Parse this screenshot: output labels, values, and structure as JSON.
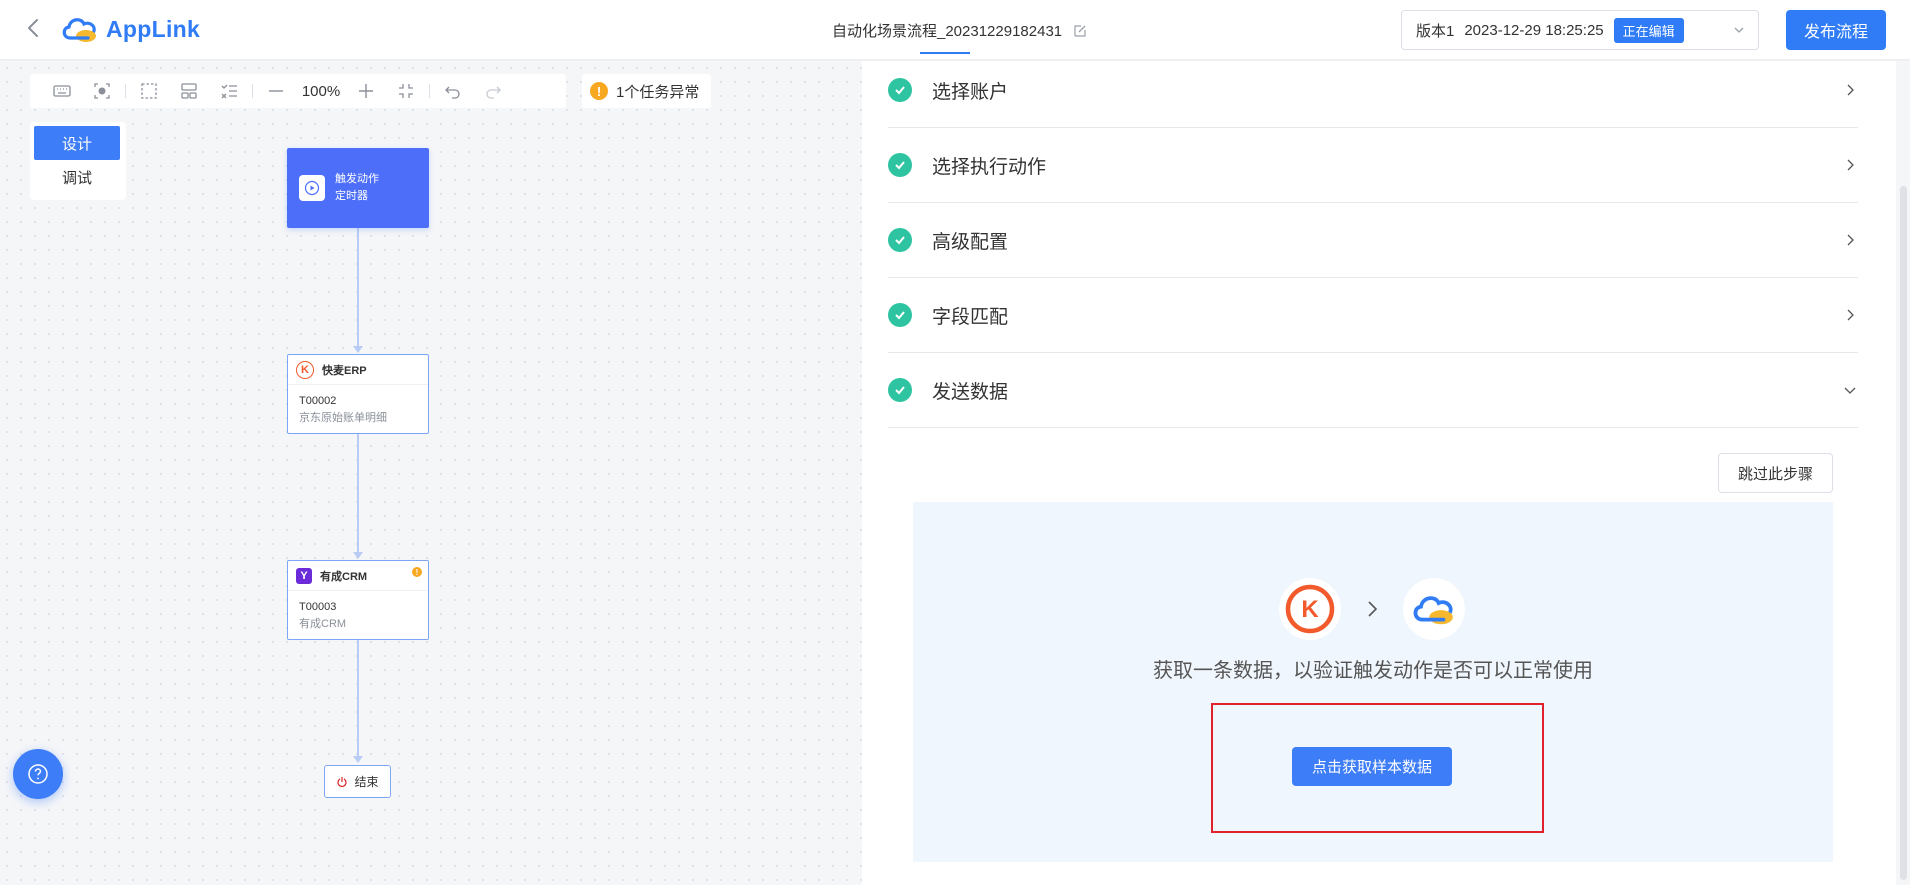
{
  "header": {
    "logo_text": "AppLink",
    "doc_title": "自动化场景流程_20231229182431",
    "version_label": "版本1",
    "version_time": "2023-12-29 18:25:25",
    "version_status": "正在编辑",
    "publish_label": "发布流程"
  },
  "toolbar": {
    "zoom": "100%",
    "task_alert": "1个任务异常",
    "icons": [
      "keyboard-icon",
      "screenshot-icon",
      "select-area-icon",
      "layout-icon",
      "list-check-icon",
      "zoom-out-icon",
      "zoom-in-icon",
      "fit-screen-icon",
      "undo-icon",
      "redo-icon"
    ]
  },
  "mode": {
    "design": "设计",
    "debug": "调试"
  },
  "flow": {
    "trigger": {
      "title": "触发动作",
      "subtitle": "定时器"
    },
    "nodes": [
      {
        "app": "快麦ERP",
        "code": "T00002",
        "desc": "京东原始账单明细",
        "logo": "K"
      },
      {
        "app": "有成CRM",
        "code": "T00003",
        "desc": "有成CRM",
        "logo": "Y",
        "warning": "!"
      }
    ],
    "end": "结束"
  },
  "steps": [
    {
      "label": "选择账户",
      "state": "done",
      "expanded": false
    },
    {
      "label": "选择执行动作",
      "state": "done",
      "expanded": false
    },
    {
      "label": "高级配置",
      "state": "done",
      "expanded": false
    },
    {
      "label": "字段匹配",
      "state": "done",
      "expanded": false
    },
    {
      "label": "发送数据",
      "state": "done",
      "expanded": true
    }
  ],
  "send_data": {
    "skip_label": "跳过此步骤",
    "description": "获取一条数据，以验证触发动作是否可以正常使用",
    "fetch_label": "点击获取样本数据",
    "source_logo": "K"
  },
  "colors": {
    "primary": "#3d7df7",
    "success": "#2ec4a1",
    "warning": "#f7a820",
    "highlight": "#e0202a",
    "kingdee": "#f25a2c"
  }
}
